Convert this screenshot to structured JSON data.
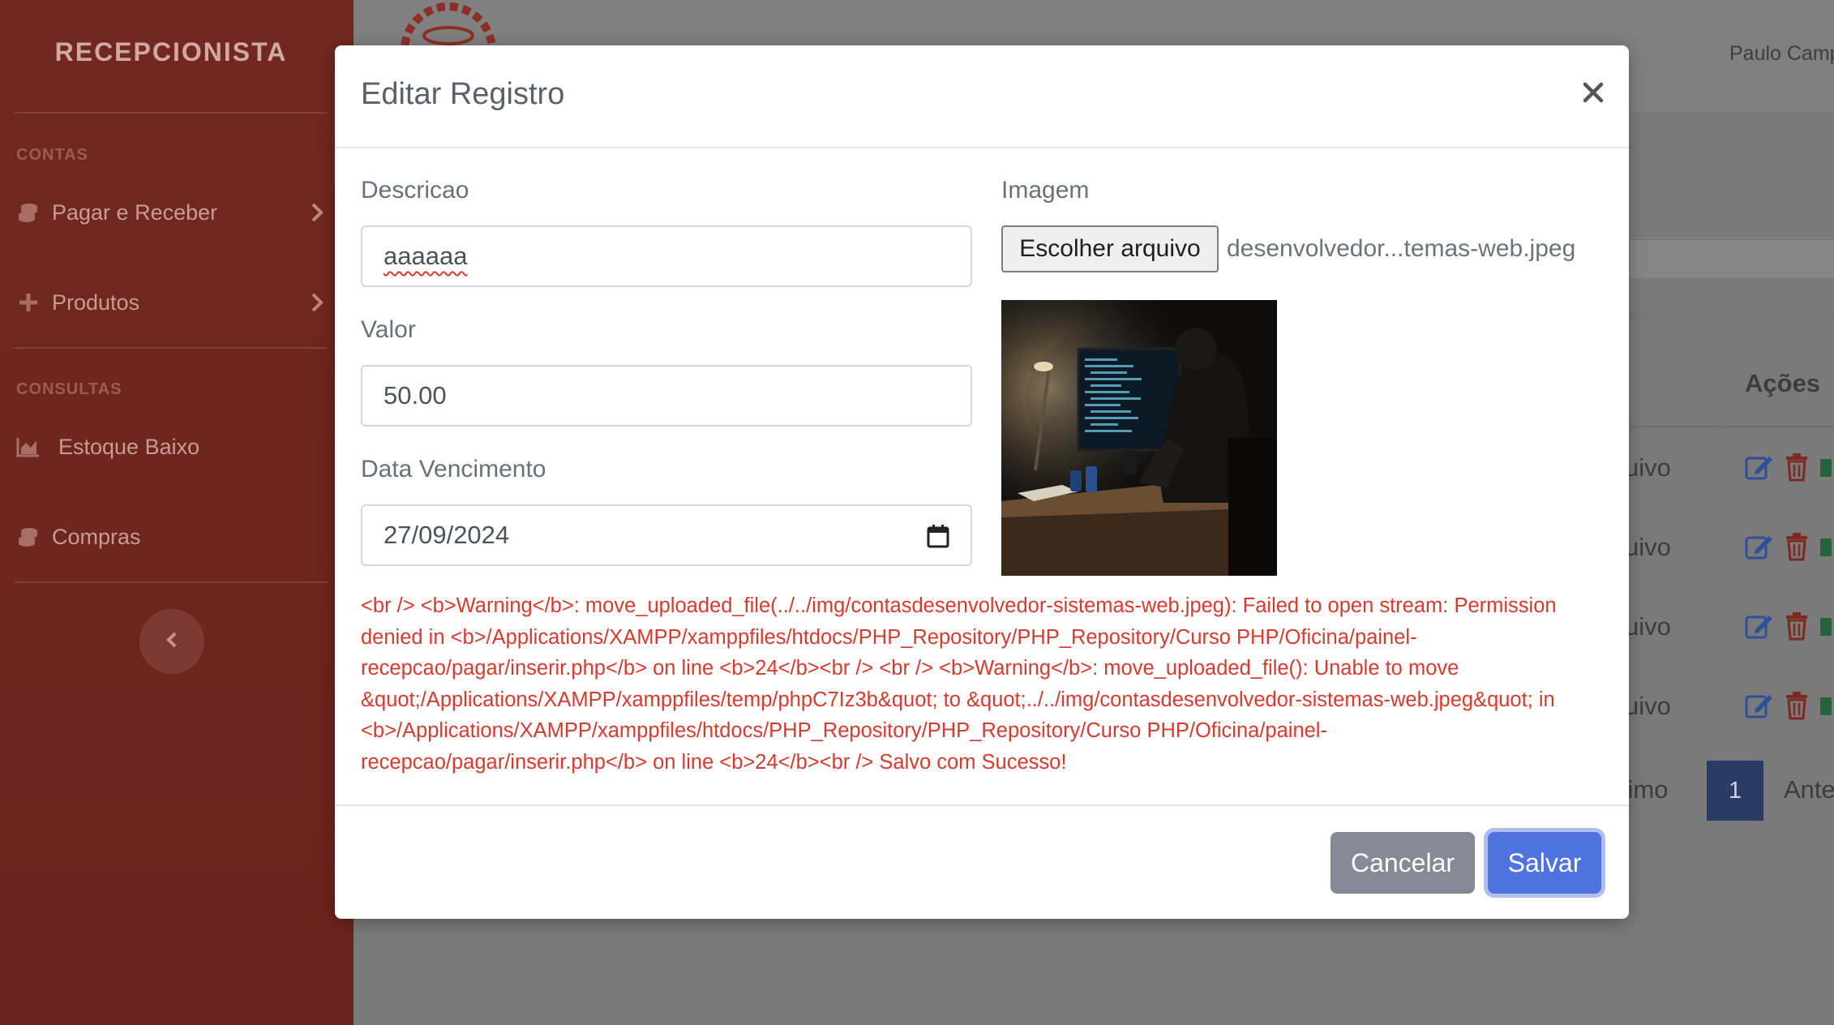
{
  "sidebar": {
    "brand": "RECEPCIONISTA",
    "sections": [
      {
        "heading": "CONTAS",
        "items": [
          {
            "label": "Pagar e Receber",
            "icon": "coins-icon"
          },
          {
            "label": "Produtos",
            "icon": "plus-icon"
          }
        ]
      },
      {
        "heading": "CONSULTAS",
        "items": [
          {
            "label": "Estoque Baixo",
            "icon": "area-chart-icon"
          },
          {
            "label": "Compras",
            "icon": "coins-icon"
          }
        ]
      }
    ]
  },
  "header": {
    "user_name": "Paulo Camp"
  },
  "background_table": {
    "actions_header": "Ações",
    "row_text": [
      "uivo",
      "uivo",
      "uivo",
      "uivo"
    ],
    "pagination": {
      "next": "ximo",
      "current": "1",
      "prev": "Ante"
    }
  },
  "modal": {
    "title": "Editar Registro",
    "fields": {
      "descricao": {
        "label": "Descricao",
        "value": "aaaaaa"
      },
      "valor": {
        "label": "Valor",
        "value": "50.00"
      },
      "data_vencimento": {
        "label": "Data Vencimento",
        "value": "27/09/2024"
      },
      "imagem": {
        "label": "Imagem",
        "button_label": "Escolher arquivo",
        "file_name": "desenvolvedor...temas-web.jpeg"
      }
    },
    "error_message": "<br /> <b>Warning</b>: move_uploaded_file(../../img/contasdesenvolvedor-sistemas-web.jpeg): Failed to open stream: Permission denied in <b>/Applications/XAMPP/xamppfiles/htdocs/PHP_Repository/PHP_Repository/Curso PHP/Oficina/painel-recepcao/pagar/inserir.php</b> on line <b>24</b><br /> <br /> <b>Warning</b>: move_uploaded_file(): Unable to move &quot;/Applications/XAMPP/xamppfiles/temp/phpC7Iz3b&quot; to &quot;../../img/contasdesenvolvedor-sistemas-web.jpeg&quot; in <b>/Applications/XAMPP/xamppfiles/htdocs/PHP_Repository/PHP_Repository/Curso PHP/Oficina/painel-recepcao/pagar/inserir.php</b> on line <b>24</b><br /> Salvo com Sucesso!",
    "buttons": {
      "cancel": "Cancelar",
      "save": "Salvar"
    }
  },
  "colors": {
    "sidebar": "#722820",
    "primary": "#4e73df",
    "secondary": "#858a96",
    "error": "#d73a2e",
    "pagination_active": "#2c3a66"
  }
}
